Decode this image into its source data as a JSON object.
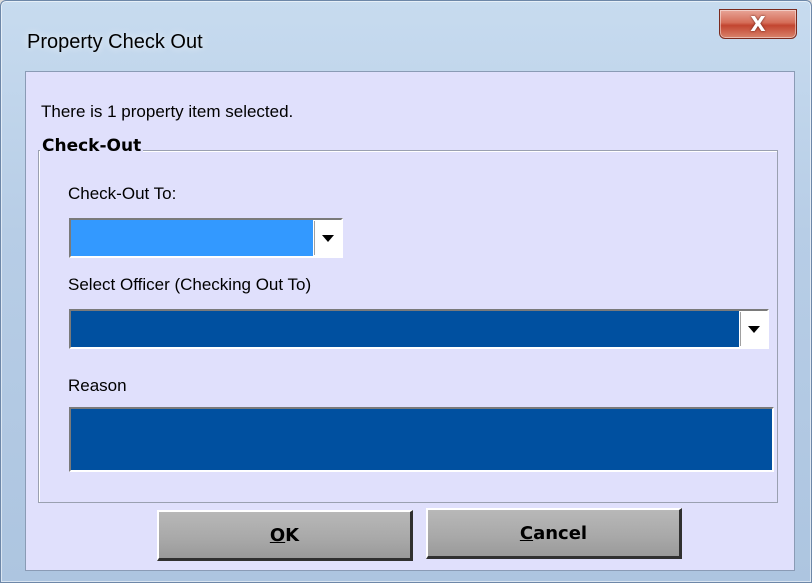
{
  "window": {
    "title": "Property Check Out",
    "close_glyph": "X"
  },
  "info_text": "There is 1 property item selected.",
  "group": {
    "legend": "Check-Out",
    "checkout_to": {
      "label": "Check-Out To:",
      "value": "",
      "field_color": "#3399ff"
    },
    "officer": {
      "label": "Select Officer (Checking Out To)",
      "value": "",
      "field_color": "#0050a0"
    },
    "reason": {
      "label": "Reason",
      "value": "",
      "field_color": "#0050a0"
    }
  },
  "buttons": {
    "ok": {
      "mnemonic": "O",
      "rest": "K"
    },
    "cancel": {
      "mnemonic": "C",
      "rest": "ancel"
    }
  },
  "icons": {
    "close": "close-icon",
    "dropdown": "chevron-down-icon"
  }
}
